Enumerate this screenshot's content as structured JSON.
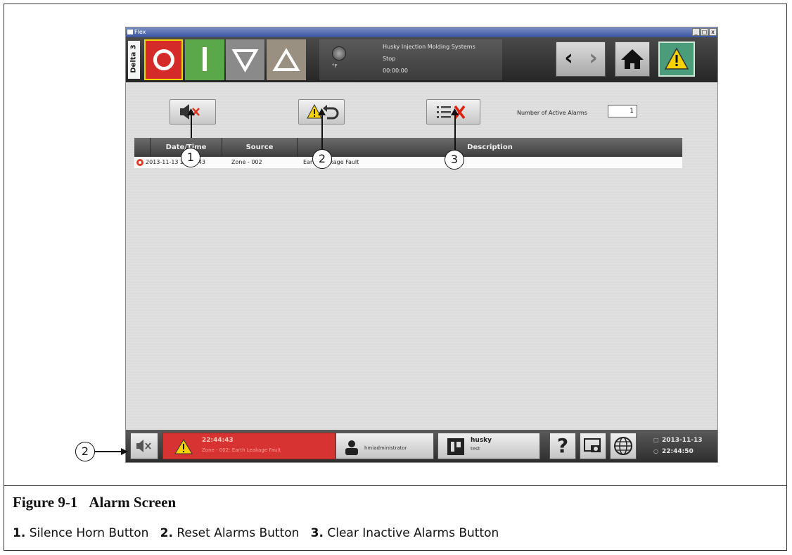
{
  "window": {
    "title": "Flex",
    "controls": [
      "_",
      "□",
      "x"
    ]
  },
  "header": {
    "delta_tab": "Delta 3",
    "status": {
      "unit": "°F",
      "company": "Husky Injection Molding Systems",
      "state": "Stop",
      "timer": "00:00:00"
    }
  },
  "toolbar": {
    "active_alarms_label": "Number of Active Alarms",
    "active_alarms_count": "1"
  },
  "table": {
    "columns": [
      "Date/Time",
      "Source",
      "Description"
    ],
    "rows": [
      {
        "datetime": "2013-11-13 22:44:43",
        "source": "Zone - 002",
        "description": "Earth Leakage Fault"
      }
    ]
  },
  "footer": {
    "alarm_time": "22:44:43",
    "alarm_message": "Zone - 002: Earth Leakage Fault",
    "user": "hmiadministrator",
    "mold_name": "husky",
    "mold_sub": "test",
    "date": "2013-11-13",
    "time": "22:44:50"
  },
  "callouts": [
    "1",
    "2",
    "3",
    "2"
  ],
  "figure": {
    "number": "Figure 9-1",
    "title": "Alarm Screen",
    "items": [
      {
        "num": "1.",
        "label": "Silence Horn Button"
      },
      {
        "num": "2.",
        "label": "Reset Alarms Button"
      },
      {
        "num": "3.",
        "label": "Clear Inactive Alarms Button"
      }
    ]
  },
  "colors": {
    "stop": "#d52a2a",
    "run": "#5aa84a",
    "alarm_bar": "#d83333",
    "alarm_button": "#4a9c7a",
    "warning": "#f5d200"
  }
}
